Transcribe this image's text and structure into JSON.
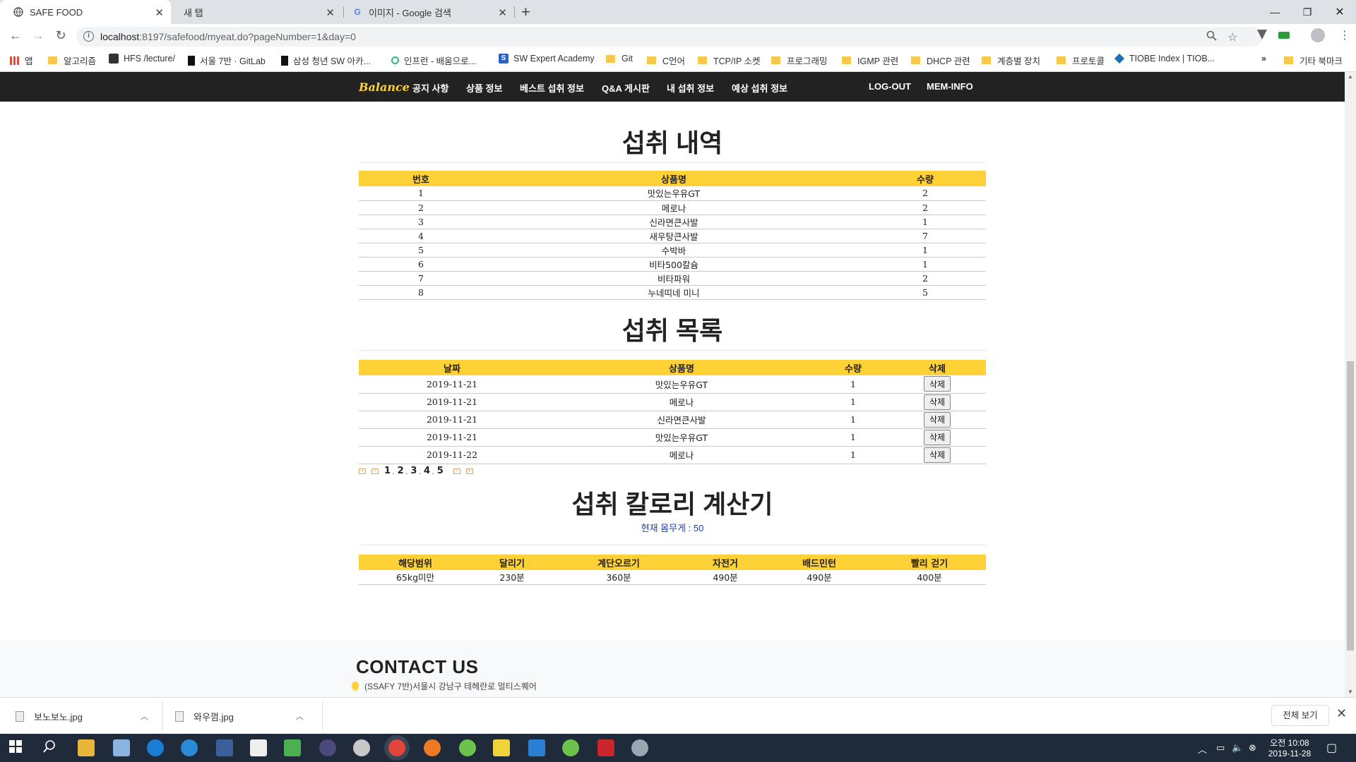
{
  "browser": {
    "tabs": [
      {
        "title": "SAFE FOOD",
        "active": true
      },
      {
        "title": "새 탭",
        "active": false
      },
      {
        "title": "이미지 - Google 검색",
        "active": false
      }
    ],
    "url_host": "localhost",
    "url_rest": ":8197/safefood/myeat.do?pageNumber=1&day=0",
    "bookmarks": [
      "앱",
      "알고리즘",
      "HFS /lecture/",
      "서울 7반 · GitLab",
      "삼성 청년 SW 아카...",
      "인프런 - 배움으로...",
      "SW Expert Academy",
      "Git",
      "C언어",
      "TCP/IP 소켓",
      "프로그래밍",
      "IGMP 관련",
      "DHCP 관련",
      "계층별 장치",
      "프로토콜",
      "TIOBE Index | TIOB...",
      "»",
      "기타 북마크"
    ]
  },
  "nav": {
    "brand": "Balance",
    "menu": [
      "공지 사항",
      "상품 정보",
      "베스트 섭취 정보",
      "Q&A 게시판",
      "내 섭취 정보",
      "예상 섭취 정보"
    ],
    "right": [
      "LOG-OUT",
      "MEM-INFO"
    ]
  },
  "history": {
    "title": "섭취 내역",
    "headers": [
      "번호",
      "상품명",
      "수량"
    ],
    "rows": [
      [
        "1",
        "맛있는우유GT",
        "2"
      ],
      [
        "2",
        "메로나",
        "2"
      ],
      [
        "3",
        "신라면큰사발",
        "1"
      ],
      [
        "4",
        "새우탕큰사발",
        "7"
      ],
      [
        "5",
        "수박바",
        "1"
      ],
      [
        "6",
        "비타500칼슘",
        "1"
      ],
      [
        "7",
        "비타파워",
        "2"
      ],
      [
        "8",
        "누네띠네 미니",
        "5"
      ]
    ]
  },
  "intake_list": {
    "title": "섭취 목록",
    "headers": [
      "날짜",
      "상품명",
      "수량",
      "삭제"
    ],
    "delete_label": "삭제",
    "rows": [
      [
        "2019-11-21",
        "맛있는우유GT",
        "1"
      ],
      [
        "2019-11-21",
        "메로나",
        "1"
      ],
      [
        "2019-11-21",
        "신라면큰사발",
        "1"
      ],
      [
        "2019-11-21",
        "맛있는우유GT",
        "1"
      ],
      [
        "2019-11-22",
        "메로나",
        "1"
      ]
    ],
    "pages": [
      "1",
      "2",
      "3",
      "4",
      "5"
    ]
  },
  "calorie": {
    "title": "섭취 칼로리 계산기",
    "weight_text": "현재 몸무게 : 50",
    "headers": [
      "해당범위",
      "달리기",
      "계단오르기",
      "자전거",
      "배드민턴",
      "빨리 걷기"
    ],
    "row": [
      "65kg미만",
      "230분",
      "360분",
      "490분",
      "490분",
      "400분"
    ]
  },
  "contact": {
    "title": "CONTACT US",
    "address": "(SSAFY 7반)서울시 강남구 테헤란로 멀티스퀘어"
  },
  "downloads": {
    "files": [
      "보노보노.jpg",
      "와우껌.jpg"
    ],
    "show_all": "전체 보기"
  },
  "taskbar": {
    "time": "오전 10:08",
    "date": "2019-11-28"
  }
}
